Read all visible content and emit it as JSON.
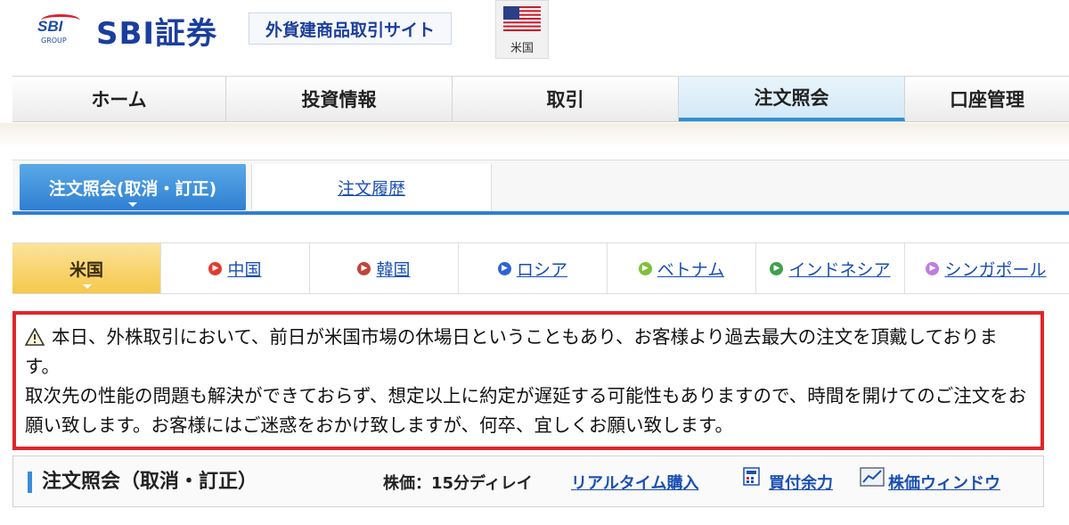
{
  "header": {
    "logo_text": "SBI",
    "logo_group": "GROUP",
    "brand": "SBI証券",
    "site_label": "外貨建商品取引サイト",
    "country_label": "米国"
  },
  "nav": {
    "items": [
      {
        "label": "ホーム"
      },
      {
        "label": "投資情報"
      },
      {
        "label": "取引"
      },
      {
        "label": "注文照会"
      },
      {
        "label": "口座管理"
      }
    ]
  },
  "subtabs": {
    "active": "注文照会(取消・訂正)",
    "history": "注文履歴"
  },
  "markets": {
    "items": [
      {
        "label": "米国",
        "color": "#f5c84b"
      },
      {
        "label": "中国",
        "color": "#e23b2e"
      },
      {
        "label": "韓国",
        "color": "#c0443a"
      },
      {
        "label": "ロシア",
        "color": "#2f64d6"
      },
      {
        "label": "ベトナム",
        "color": "#7fbf3a"
      },
      {
        "label": "インドネシア",
        "color": "#3da24a"
      },
      {
        "label": "シンガポール",
        "color": "#c27be0"
      }
    ]
  },
  "notice": {
    "line1": "本日、外株取引において、前日が米国市場の休場日ということもあり、お客様より過去最大の注文を頂戴しております。",
    "line2": "取次先の性能の問題も解決ができておらず、想定以上に約定が遅延する可能性もありますので、時間を開けてのご注文をお願い致します。お客様にはご迷惑をおかけ致しますが、何卒、宜しくお願い致します。"
  },
  "bottom": {
    "title": "注文照会（取消・訂正）",
    "delay": "株価：15分ディレイ",
    "realtime": "リアルタイム購入",
    "buying_power": "買付余力",
    "price_window": "株価ウィンドウ"
  }
}
